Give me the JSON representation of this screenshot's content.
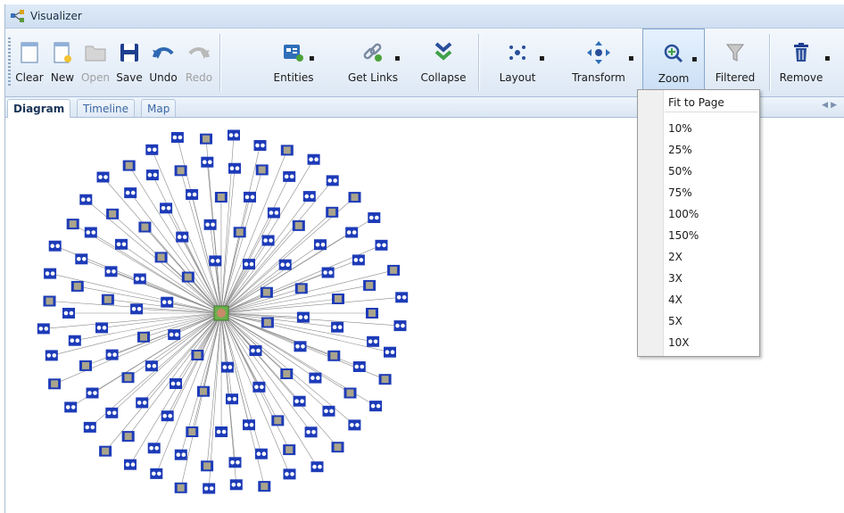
{
  "window": {
    "title": "Visualizer"
  },
  "toolbar": {
    "buttons": [
      {
        "label": "Clear",
        "icon": "clear-page-icon",
        "enabled": true
      },
      {
        "label": "New",
        "icon": "new-page-icon",
        "enabled": true
      },
      {
        "label": "Open",
        "icon": "folder-icon",
        "enabled": false
      },
      {
        "label": "Save",
        "icon": "floppy-disk-icon",
        "enabled": true
      },
      {
        "label": "Undo",
        "icon": "undo-icon",
        "enabled": true
      },
      {
        "label": "Redo",
        "icon": "redo-icon",
        "enabled": false
      },
      {
        "label": "Entities",
        "icon": "entities-icon",
        "enabled": true
      },
      {
        "label": "Get Links",
        "icon": "chain-link-icon",
        "enabled": true
      },
      {
        "label": "Collapse",
        "icon": "collapse-icon",
        "enabled": true
      },
      {
        "label": "Layout",
        "icon": "layout-icon",
        "enabled": true
      },
      {
        "label": "Transform",
        "icon": "transform-arrows-icon",
        "enabled": true
      },
      {
        "label": "Zoom",
        "icon": "zoom-in-icon",
        "enabled": true,
        "active": true
      },
      {
        "label": "Filtered",
        "icon": "funnel-icon",
        "enabled": true
      },
      {
        "label": "Remove",
        "icon": "trash-icon",
        "enabled": true
      }
    ]
  },
  "tabs": [
    {
      "label": "Diagram",
      "selected": true
    },
    {
      "label": "Timeline",
      "selected": false
    },
    {
      "label": "Map",
      "selected": false
    }
  ],
  "zoom_menu": {
    "items": [
      "Fit to Page",
      "10%",
      "25%",
      "50%",
      "75%",
      "100%",
      "150%",
      "2X",
      "3X",
      "4X",
      "5X",
      "10X"
    ]
  },
  "graph": {
    "center_icon": "person-photo-icon",
    "node_icons": [
      "document-node-icon",
      "link-node-icon"
    ],
    "colors": {
      "node_blue": "#1d3bb8",
      "edge": "#8a8a8a",
      "center_green": "#6ab04c"
    }
  }
}
